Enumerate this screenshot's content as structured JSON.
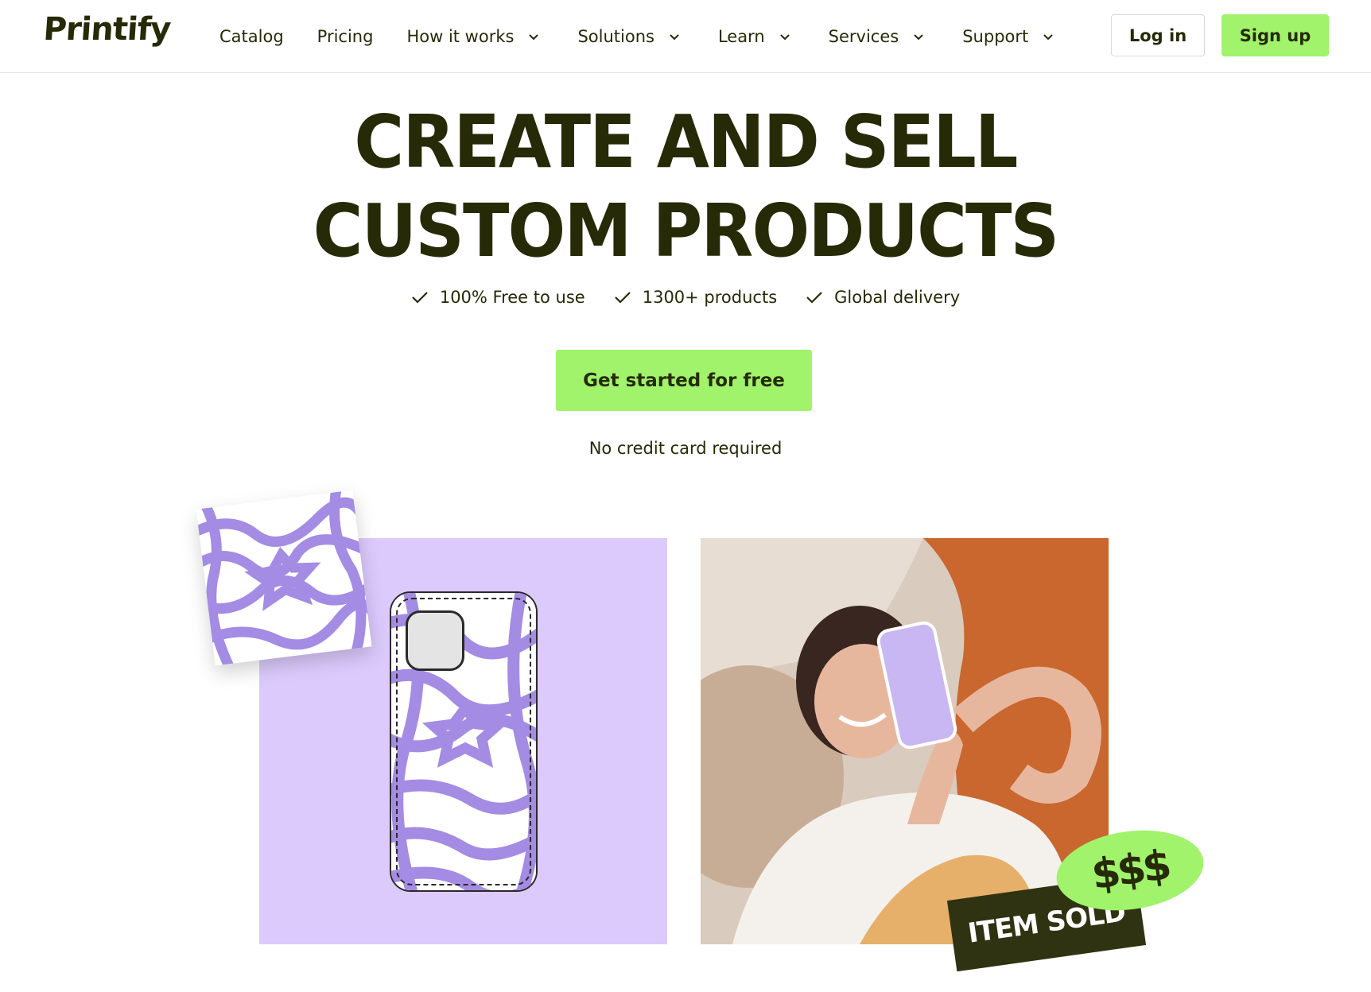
{
  "header": {
    "logo": "Printify",
    "nav": [
      {
        "label": "Catalog",
        "has_dropdown": false
      },
      {
        "label": "Pricing",
        "has_dropdown": false
      },
      {
        "label": "How it works",
        "has_dropdown": true
      },
      {
        "label": "Solutions",
        "has_dropdown": true
      },
      {
        "label": "Learn",
        "has_dropdown": true
      },
      {
        "label": "Services",
        "has_dropdown": true
      },
      {
        "label": "Support",
        "has_dropdown": true
      }
    ],
    "login_label": "Log in",
    "signup_label": "Sign up"
  },
  "hero": {
    "title_line1": "CREATE AND SELL",
    "title_line2": "CUSTOM PRODUCTS",
    "features": [
      "100% Free to use",
      "1300+ products",
      "Global delivery"
    ],
    "cta_label": "Get started for free",
    "cta_note": "No credit card required"
  },
  "illustrations": {
    "money_badge": "$$$",
    "sold_tag": "ITEM SOLD"
  },
  "colors": {
    "accent": "#a0f36b",
    "text": "#272a07",
    "lavender": "#dccafd",
    "swirl": "#a48be3"
  }
}
